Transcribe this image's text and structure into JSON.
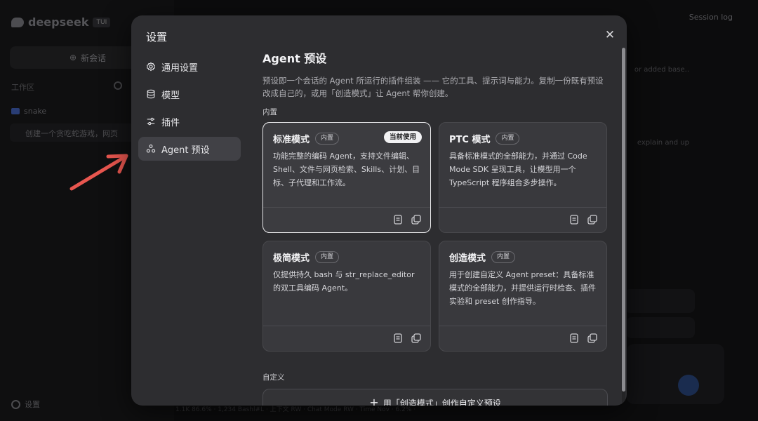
{
  "modal": {
    "title": "设置",
    "close_icon": "close-icon"
  },
  "nav": [
    {
      "label": "通用设置",
      "icon": "gear-icon",
      "active": false
    },
    {
      "label": "模型",
      "icon": "database-icon",
      "active": false
    },
    {
      "label": "插件",
      "icon": "sliders-icon",
      "active": false
    },
    {
      "label": "Agent 预设",
      "icon": "agent-preset-icon",
      "active": true
    }
  ],
  "content": {
    "title": "Agent 预设",
    "description": "预设即一个会话的 Agent 所运行的插件组装 —— 它的工具、提示词与能力。复制一份既有预设改成自己的，或用「创造模式」让 Agent 帮你创建。",
    "builtin_label": "内置",
    "custom_label": "自定义",
    "create_button": "用「创造模式」创作自定义预设"
  },
  "presets": [
    {
      "name": "标准模式",
      "badge": "内置",
      "current_badge": "当前使用",
      "is_current": true,
      "description": "功能完整的编码 Agent，支持文件编辑、Shell、文件与网页检索、Skills、计划、目标、子代理和工作流。",
      "actions": [
        "document-icon",
        "copy-icon"
      ]
    },
    {
      "name": "PTC 模式",
      "badge": "内置",
      "is_current": false,
      "description": "具备标准模式的全部能力，并通过 Code Mode SDK 呈现工具，让模型用一个 TypeScript 程序组合多步操作。",
      "actions": [
        "document-icon",
        "copy-icon"
      ]
    },
    {
      "name": "极简模式",
      "badge": "内置",
      "is_current": false,
      "description": "仅提供持久 bash 与 str_replace_editor 的双工具编码 Agent。",
      "actions": [
        "document-icon",
        "copy-icon"
      ]
    },
    {
      "name": "创造模式",
      "badge": "内置",
      "is_current": false,
      "description": "用于创建自定义 Agent preset：具备标准模式的全部能力，并提供运行时检查、插件实验和 preset 创作指导。",
      "actions": [
        "document-icon",
        "copy-icon"
      ]
    }
  ],
  "background": {
    "logo": "deepseek",
    "version": "TUI",
    "new_chat": "新会话",
    "workspace": "工作区",
    "folder": "snake",
    "session": "创建一个贪吃蛇游戏，网页",
    "settings": "设置",
    "session_log": "Session log",
    "right_text_1": "or added base..",
    "right_text_2": "explain and up",
    "status": "1.1K  86.6%   ·   1,234 Bashl#L  ·  上下文  RW  ·  Chat Mode RW  ·  Time Nov  ·  6.2%  ·"
  },
  "colors": {
    "modal_bg": "#2d2d30",
    "card_bg": "#39393d",
    "accent_arrow": "#e8564f",
    "current_badge_bg": "#f2f2f4"
  }
}
